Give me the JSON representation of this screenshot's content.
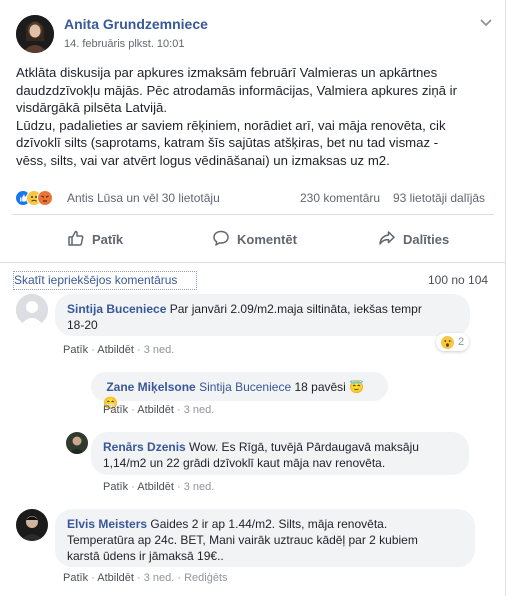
{
  "post": {
    "author": "Anita Grundzemniece",
    "timestamp": "14. februāris plkst. 10:01",
    "text_lines": [
      "Atklāta diskusija par apkures izmaksām februārī Valmieras un apkārtnes",
      "daudzdzīvokļu mājās. Pēc atrodamās informācijas, Valmiera apkures ziņā ir",
      "visdārgākā pilsēta Latvijā.",
      "Lūdzu, padalieties ar saviem rēķiniem, norādiet arī, vai māja renovēta, cik",
      "dzīvoklī silts (saprotams, katram šīs sajūtas atšķiras, bet nu tad vismaz -",
      "vēss, silts, vai var atvērt logus vēdināšanai) un izmaksas uz m2."
    ],
    "reactions_text": "Antis Lūsa un vēl 30 lietotāju",
    "comments_count": "230 komentāru",
    "shares_count": "93 lietotāji dalījās",
    "actions": {
      "like": "Patīk",
      "comment": "Komentēt",
      "share": "Dalīties"
    }
  },
  "comments_header": {
    "view_previous": "Skatīt iepriekšējos komentārus",
    "count": "100 no 104"
  },
  "comments": [
    {
      "author": "Sintija Buceniece",
      "text_lines": [
        "Par janvāri 2.09/m2.maja siltināta, iekšas tempr",
        "18-20"
      ],
      "reaction_count": "2",
      "like": "Patīk",
      "reply": "Atbildēt",
      "time": "3 ned."
    },
    {
      "author": "Zane Miķelsone",
      "mention": "Sintija Buceniece",
      "text": "18 pavēsi",
      "like": "Patīk",
      "reply": "Atbildēt",
      "time": "3 ned."
    },
    {
      "author": "Renārs Dzenis",
      "text_lines": [
        "Wow. Es Rīgā, tuvējā Pārdaugavā maksāju",
        "1,14/m2 un 22 grādi dzīvoklī kaut māja nav renovēta."
      ],
      "like": "Patīk",
      "reply": "Atbildēt",
      "time": "3 ned."
    },
    {
      "author": "Elvis Meisters",
      "text_lines": [
        "Gaides 2 ir ap 1.44/m2. Silts, māja renovēta.",
        "Temperatūra ap 24c. BET, Mani vairāk uztrauc kādēļ par 2 kubiem",
        "karstā ūdens ir jāmaksā 19€.."
      ],
      "like": "Patīk",
      "reply": "Atbildēt",
      "time": "3 ned.",
      "edited": "Rediģēts"
    }
  ],
  "colors": {
    "link": "#385898",
    "bubble": "#f2f3f5",
    "meta": "#90949c",
    "like_blue": "#1877f2"
  },
  "icons": [
    "chevron-down-icon",
    "like-icon",
    "comment-icon",
    "share-icon",
    "reaction-like-icon",
    "reaction-sad-icon",
    "reaction-angry-icon",
    "reaction-wow-icon"
  ]
}
